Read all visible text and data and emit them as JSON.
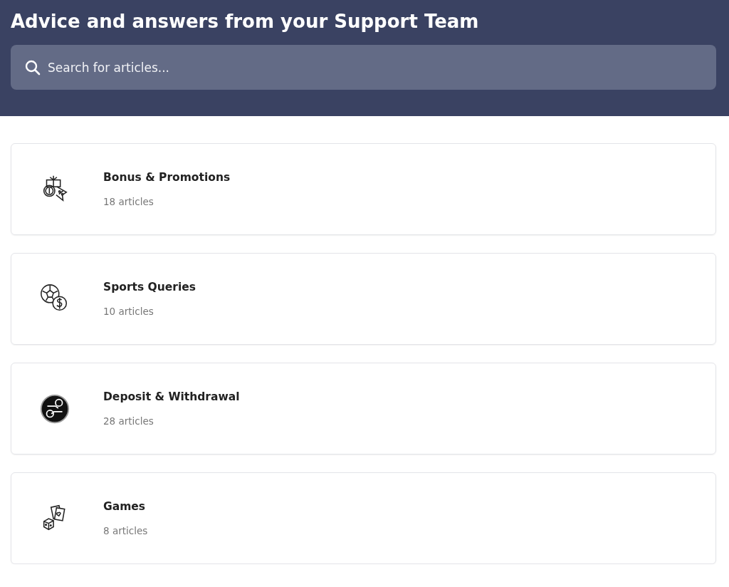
{
  "header": {
    "title": "Advice and answers from your Support Team",
    "search": {
      "placeholder": "Search for articles..."
    }
  },
  "collections": [
    {
      "kind": "gift",
      "title": "Bonus & Promotions",
      "count": "18 articles"
    },
    {
      "kind": "ball",
      "title": "Sports Queries",
      "count": "10 articles"
    },
    {
      "kind": "exchange",
      "title": "Deposit & Withdrawal",
      "count": "28 articles"
    },
    {
      "kind": "cards",
      "title": "Games",
      "count": "8 articles"
    }
  ]
}
